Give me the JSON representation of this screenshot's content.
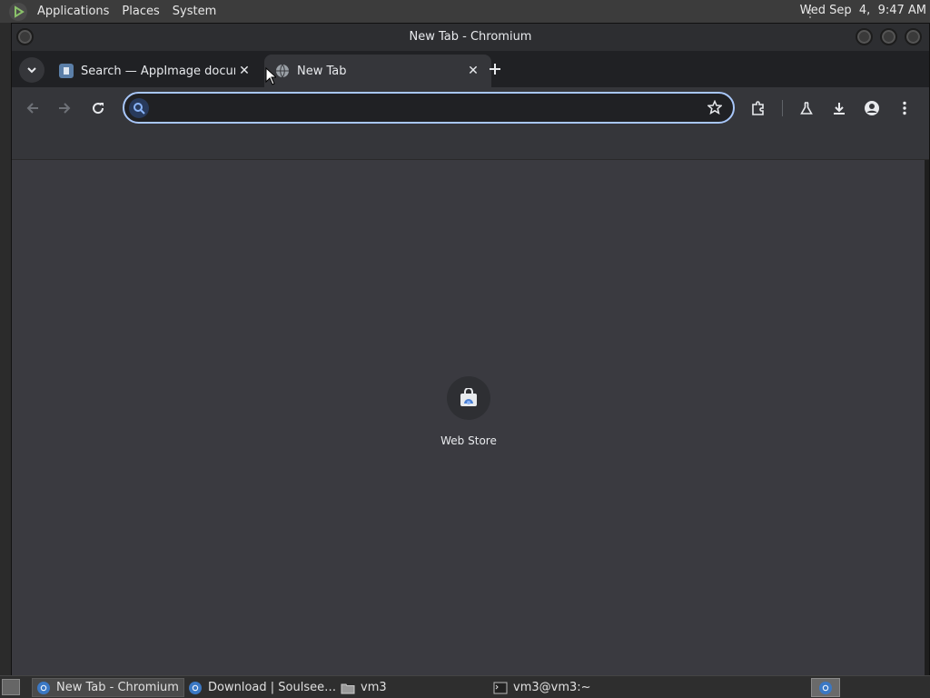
{
  "system_bar": {
    "menus": [
      "Applications",
      "Places",
      "System"
    ],
    "clock": "Wed Sep  4,  9:47 AM"
  },
  "window": {
    "title": "New Tab - Chromium"
  },
  "tabs": [
    {
      "title": "Search — AppImage docume",
      "active": false,
      "icon": "doc-search-icon"
    },
    {
      "title": "New Tab",
      "active": true,
      "icon": "globe-icon"
    }
  ],
  "omnibox": {
    "value": "",
    "placeholder": ""
  },
  "new_tab_page": {
    "shortcuts": [
      {
        "label": "Web Store",
        "icon": "web-store-icon"
      }
    ]
  },
  "taskbar": {
    "tasks": [
      {
        "label": "New Tab - Chromium",
        "active": true,
        "icon": "chromium-icon"
      },
      {
        "label": "Download | Soulsee…",
        "active": false,
        "icon": "chromium-icon"
      },
      {
        "label": "vm3",
        "active": false,
        "icon": "folder-icon"
      },
      {
        "label": "vm3@vm3:~",
        "active": false,
        "icon": "terminal-icon"
      }
    ]
  },
  "colors": {
    "accent": "#a8c7fa",
    "content_bg": "#3a3a40",
    "toolbar_bg": "#35363a"
  }
}
